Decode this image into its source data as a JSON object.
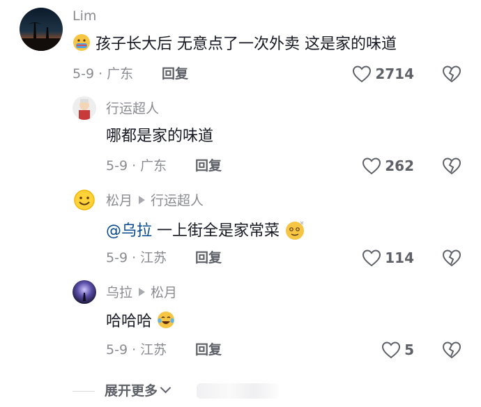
{
  "comments": [
    {
      "username": "Lim",
      "text": "孩子长大后 无意点了一次外卖 这是家的味道",
      "date_location": "5-9 · 广东",
      "reply_label": "回复",
      "likes": "2714"
    }
  ],
  "replies": [
    {
      "username": "行运超人",
      "text": "哪都是家的味道",
      "date_location": "5-9 · 广东",
      "reply_label": "回复",
      "likes": "262"
    },
    {
      "username": "松月",
      "reply_to": "行运超人",
      "mention": "@乌拉",
      "text": " 一上街全是家常菜",
      "date_location": "5-9 · 江苏",
      "reply_label": "回复",
      "likes": "114"
    },
    {
      "username": "乌拉",
      "reply_to": "松月",
      "text": "哈哈哈",
      "date_location": "5-9 · 江苏",
      "reply_label": "回复",
      "likes": "5"
    }
  ],
  "expand_label": "展开更多",
  "icons": {
    "like": "heart-outline-icon",
    "dislike": "broken-heart-icon",
    "expand": "chevron-down-icon"
  },
  "colors": {
    "text": "#161823",
    "secondary": "#8a8b91",
    "mention": "#04498d"
  }
}
